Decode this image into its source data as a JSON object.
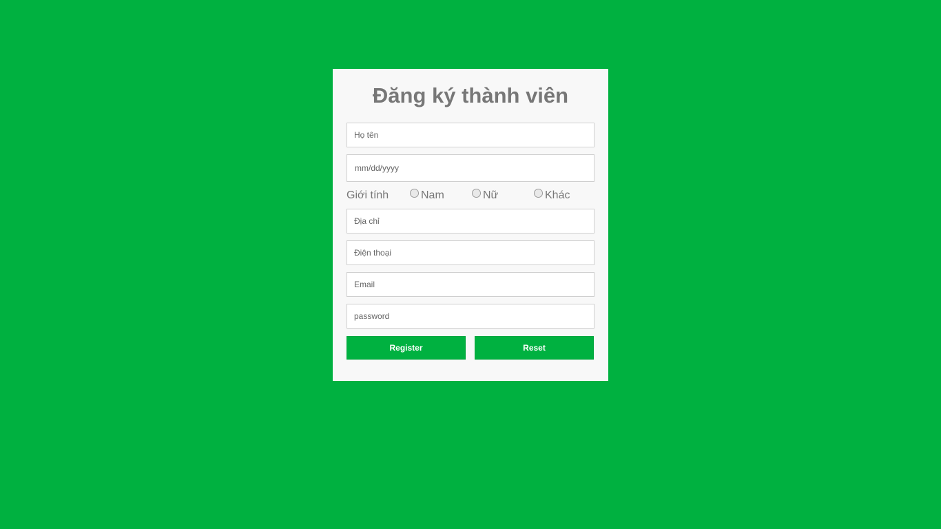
{
  "form": {
    "title": "Đăng ký thành viên",
    "fullname_placeholder": "Họ tên",
    "dob_placeholder": "mm/dd/yyyy",
    "gender_label": "Giới tính",
    "gender_options": [
      "Nam",
      "Nữ",
      "Khác"
    ],
    "address_placeholder": "Địa chỉ",
    "phone_placeholder": "Điện thoại",
    "email_placeholder": "Email",
    "password_placeholder": "password",
    "register_label": "Register",
    "reset_label": "Reset"
  },
  "colors": {
    "background": "#00b140",
    "card": "#f8f8f8",
    "button": "#00b140",
    "title_text": "#777777"
  }
}
